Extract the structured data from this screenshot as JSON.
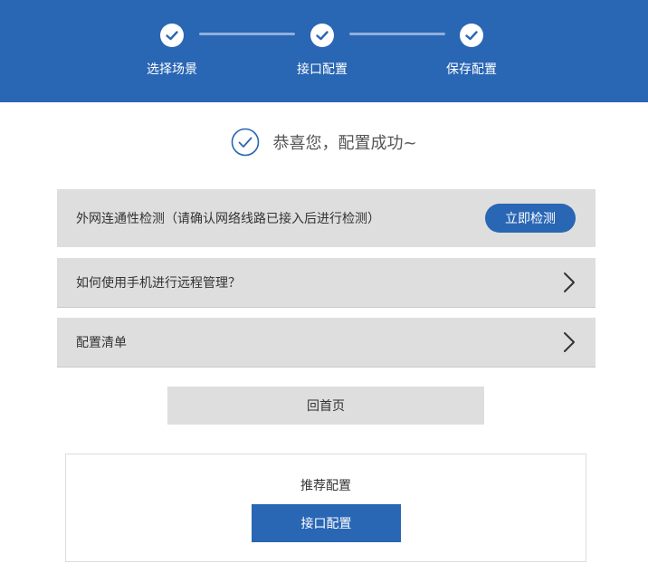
{
  "header": {
    "steps": [
      {
        "label": "选择场景",
        "icon": "check-icon"
      },
      {
        "label": "接口配置",
        "icon": "check-icon"
      },
      {
        "label": "保存配置",
        "icon": "check-icon"
      }
    ],
    "accent_color": "#2966b4"
  },
  "success": {
    "icon": "check-circle-icon",
    "text": "恭喜您，配置成功~"
  },
  "rows": {
    "connectivity": {
      "label": "外网连通性检测（请确认网络线路已接入后进行检测）",
      "button_label": "立即检测"
    },
    "remote": {
      "label": "如何使用手机进行远程管理？",
      "icon": "chevron-right-icon"
    },
    "config_list": {
      "label": "配置清单",
      "icon": "chevron-right-icon"
    }
  },
  "home_button_label": "回首页",
  "recommend": {
    "title": "推荐配置",
    "button_label": "接口配置"
  }
}
